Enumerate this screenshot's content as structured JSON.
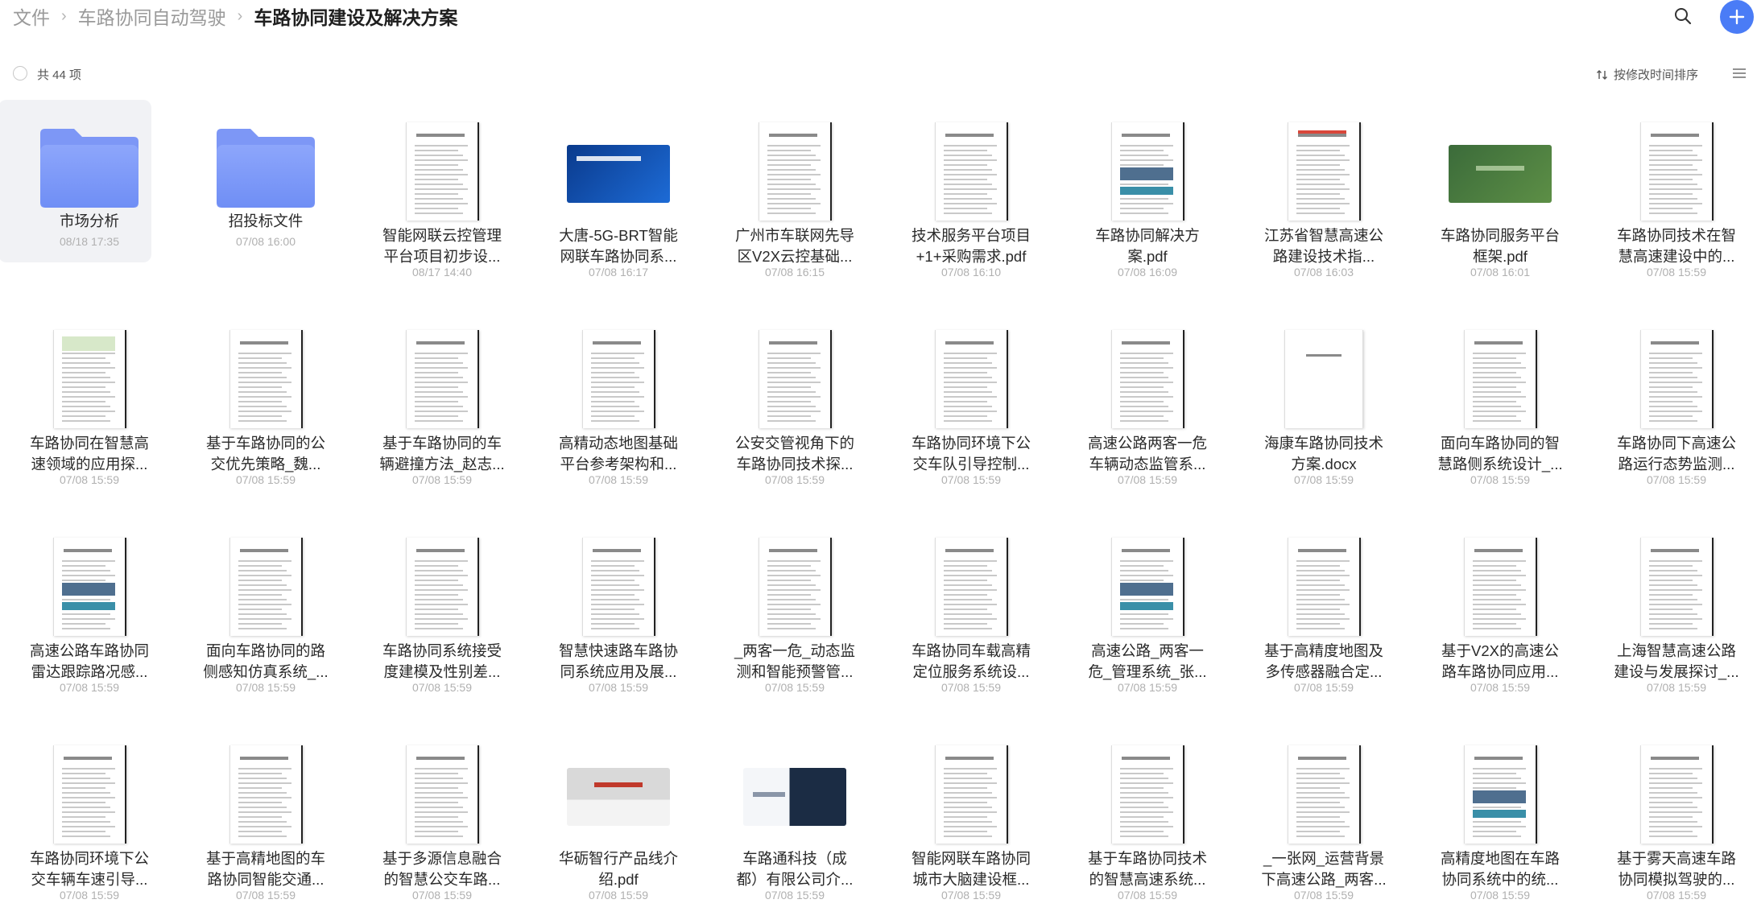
{
  "breadcrumb": {
    "items": [
      "文件",
      "车路协同自动驾驶"
    ],
    "current": "车路协同建设及解决方案"
  },
  "header": {
    "search_icon": "search-icon",
    "add_icon": "plus-icon",
    "accent": "#4a7cf6"
  },
  "toolbar": {
    "count": "共 44 项",
    "sort_label": "按修改时间排序"
  },
  "items": [
    {
      "name": [
        "市场分析"
      ],
      "time": "08/18 17:35",
      "type": "folder",
      "selected": true
    },
    {
      "name": [
        "招投标文件"
      ],
      "time": "07/08 16:00",
      "type": "folder"
    },
    {
      "name": [
        "智能网联云控管理",
        "平台项目初步设..."
      ],
      "time": "08/17 14:40",
      "type": "doc"
    },
    {
      "name": [
        "大唐-5G-BRT智能",
        "网联车路协同系..."
      ],
      "time": "07/08 16:17",
      "type": "slide-blue"
    },
    {
      "name": [
        "广州市车联网先导",
        "区V2X云控基础..."
      ],
      "time": "07/08 16:15",
      "type": "doc"
    },
    {
      "name": [
        "技术服务平台项目",
        "+1+采购需求.pdf"
      ],
      "time": "07/08 16:10",
      "type": "doc"
    },
    {
      "name": [
        "车路协同解决方",
        "案.pdf"
      ],
      "time": "07/08 16:09",
      "type": "doc-img"
    },
    {
      "name": [
        "江苏省智慧高速公",
        "路建设技术指..."
      ],
      "time": "07/08 16:03",
      "type": "doc-red"
    },
    {
      "name": [
        "车路协同服务平台",
        "框架.pdf"
      ],
      "time": "07/08 16:01",
      "type": "slide-green"
    },
    {
      "name": [
        "车路协同技术在智",
        "慧高速建设中的..."
      ],
      "time": "07/08 15:59",
      "type": "doc"
    },
    {
      "name": [
        "车路协同在智慧高",
        "速领域的应用探..."
      ],
      "time": "07/08 15:59",
      "type": "doc-green"
    },
    {
      "name": [
        "基于车路协同的公",
        "交优先策略_魏..."
      ],
      "time": "07/08 15:59",
      "type": "doc"
    },
    {
      "name": [
        "基于车路协同的车",
        "辆避撞方法_赵志..."
      ],
      "time": "07/08 15:59",
      "type": "doc"
    },
    {
      "name": [
        "高精动态地图基础",
        "平台参考架构和..."
      ],
      "time": "07/08 15:59",
      "type": "doc"
    },
    {
      "name": [
        "公安交管视角下的",
        "车路协同技术探..."
      ],
      "time": "07/08 15:59",
      "type": "doc"
    },
    {
      "name": [
        "车路协同环境下公",
        "交车队引导控制..."
      ],
      "time": "07/08 15:59",
      "type": "doc"
    },
    {
      "name": [
        "高速公路两客一危",
        "车辆动态监管系..."
      ],
      "time": "07/08 15:59",
      "type": "doc"
    },
    {
      "name": [
        "海康车路协同技术",
        "方案.docx"
      ],
      "time": "07/08 15:59",
      "type": "doc-blank"
    },
    {
      "name": [
        "面向车路协同的智",
        "慧路侧系统设计_..."
      ],
      "time": "07/08 15:59",
      "type": "doc"
    },
    {
      "name": [
        "车路协同下高速公",
        "路运行态势监测..."
      ],
      "time": "07/08 15:59",
      "type": "doc"
    },
    {
      "name": [
        "高速公路车路协同",
        "雷达跟踪路况感..."
      ],
      "time": "07/08 15:59",
      "type": "doc-img"
    },
    {
      "name": [
        "面向车路协同的路",
        "侧感知仿真系统_..."
      ],
      "time": "07/08 15:59",
      "type": "doc"
    },
    {
      "name": [
        "车路协同系统接受",
        "度建模及性别差..."
      ],
      "time": "07/08 15:59",
      "type": "doc"
    },
    {
      "name": [
        "智慧快速路车路协",
        "同系统应用及展..."
      ],
      "time": "07/08 15:59",
      "type": "doc"
    },
    {
      "name": [
        "_两客一危_动态监",
        "测和智能预警管..."
      ],
      "time": "07/08 15:59",
      "type": "doc"
    },
    {
      "name": [
        "车路协同车载高精",
        "定位服务系统设..."
      ],
      "time": "07/08 15:59",
      "type": "doc"
    },
    {
      "name": [
        "高速公路_两客一",
        "危_管理系统_张..."
      ],
      "time": "07/08 15:59",
      "type": "doc-img"
    },
    {
      "name": [
        "基于高精度地图及",
        "多传感器融合定..."
      ],
      "time": "07/08 15:59",
      "type": "doc"
    },
    {
      "name": [
        "基于V2X的高速公",
        "路车路协同应用..."
      ],
      "time": "07/08 15:59",
      "type": "doc"
    },
    {
      "name": [
        "上海智慧高速公路",
        "建设与发展探讨_..."
      ],
      "time": "07/08 15:59",
      "type": "doc"
    },
    {
      "name": [
        "车路协同环境下公",
        "交车辆车速引导..."
      ],
      "time": "07/08 15:59",
      "type": "doc"
    },
    {
      "name": [
        "基于高精地图的车",
        "路协同智能交通..."
      ],
      "time": "07/08 15:59",
      "type": "doc"
    },
    {
      "name": [
        "基于多源信息融合",
        "的智慧公交车路..."
      ],
      "time": "07/08 15:59",
      "type": "doc"
    },
    {
      "name": [
        "华砺智行产品线介",
        "绍.pdf"
      ],
      "time": "07/08 15:59",
      "type": "slide-red"
    },
    {
      "name": [
        "车路通科技（成",
        "都）有限公司介..."
      ],
      "time": "07/08 15:59",
      "type": "slide-dark"
    },
    {
      "name": [
        "智能网联车路协同",
        "城市大脑建设框..."
      ],
      "time": "07/08 15:59",
      "type": "doc"
    },
    {
      "name": [
        "基于车路协同技术",
        "的智慧高速系统..."
      ],
      "time": "07/08 15:59",
      "type": "doc"
    },
    {
      "name": [
        "_一张网_运营背景",
        "下高速公路_两客..."
      ],
      "time": "07/08 15:59",
      "type": "doc"
    },
    {
      "name": [
        "高精度地图在车路",
        "协同系统中的统..."
      ],
      "time": "07/08 15:59",
      "type": "doc-img"
    },
    {
      "name": [
        "基于雾天高速车路",
        "协同模拟驾驶的..."
      ],
      "time": "07/08 15:59",
      "type": "doc"
    }
  ]
}
